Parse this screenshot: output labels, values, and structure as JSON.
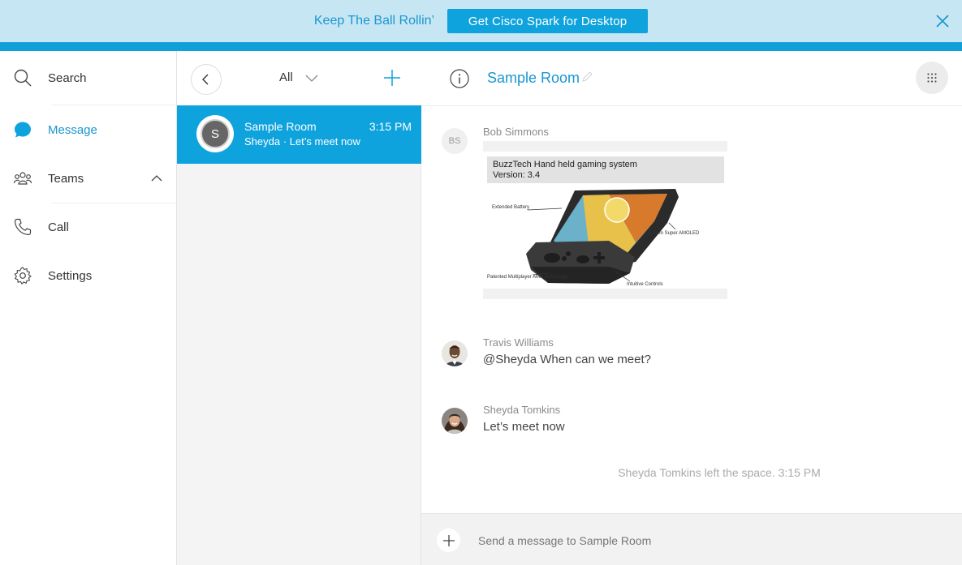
{
  "banner": {
    "text": "Keep The Ball Rollin’",
    "cta_label": "Get Cisco Spark for Desktop",
    "close_icon": "close-icon"
  },
  "nav": {
    "items": [
      {
        "label": "Search",
        "icon": "search-icon"
      },
      {
        "label": "Message",
        "icon": "message-bubble-icon",
        "active": true
      },
      {
        "label": "Teams",
        "icon": "teams-icon",
        "expand_icon": "chevron-up-icon"
      },
      {
        "label": "Call",
        "icon": "phone-icon"
      },
      {
        "label": "Settings",
        "icon": "gear-icon"
      }
    ]
  },
  "space_list": {
    "filter_label": "All",
    "rooms": [
      {
        "avatar_initial": "S",
        "name": "Sample Room",
        "time": "3:15 PM",
        "preview": "Sheyda · Let’s meet now",
        "selected": true
      }
    ]
  },
  "room": {
    "title": "Sample Room",
    "messages": [
      {
        "sender": "Bob Simmons",
        "initials": "BS",
        "attachment": {
          "title_line1": "BuzzTech Hand held gaming system",
          "title_line2": "Version: 3.4",
          "callouts": [
            "Extended Battery",
            "Screen Super AMOLED",
            "Patented Multiplayer AMP technology",
            "Intuitive Controls"
          ]
        }
      },
      {
        "sender": "Travis Williams",
        "text": "@Sheyda When can we meet?"
      },
      {
        "sender": "Sheyda Tomkins",
        "text": "Let’s meet now"
      }
    ],
    "system_messages": [
      "Sheyda Tomkins left the space.  3:15 PM"
    ],
    "composer_placeholder": "Send a message to Sample Room"
  },
  "colors": {
    "accent": "#0fa3dd",
    "banner_bg": "#c7e6f4",
    "link_text": "#1a97cf"
  }
}
